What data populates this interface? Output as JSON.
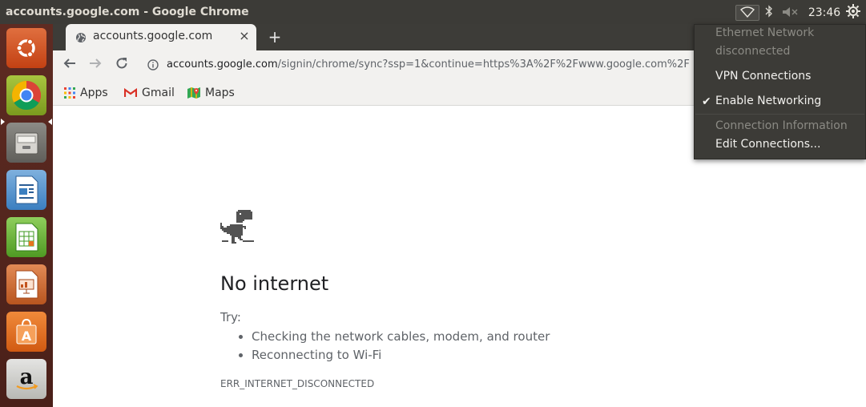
{
  "topbar": {
    "window_title": "accounts.google.com - Google Chrome",
    "indicators": {
      "network_icon": "wifi-icon",
      "bluetooth_icon": "bluetooth-icon",
      "volume_icon": "volume-muted-icon",
      "clock": "23:46",
      "session_icon": "gear-icon"
    }
  },
  "launcher": {
    "items": [
      {
        "name": "ubuntu-dash",
        "icon": "ubuntu-logo-icon"
      },
      {
        "name": "google-chrome",
        "icon": "chrome-icon",
        "active": true
      },
      {
        "name": "files",
        "icon": "file-cabinet-icon"
      },
      {
        "name": "libreoffice-writer",
        "icon": "writer-icon"
      },
      {
        "name": "libreoffice-calc",
        "icon": "calc-icon"
      },
      {
        "name": "libreoffice-impress",
        "icon": "impress-icon"
      },
      {
        "name": "ubuntu-software",
        "icon": "shopping-bag-icon"
      },
      {
        "name": "amazon",
        "icon": "amazon-icon"
      }
    ]
  },
  "browser": {
    "tab": {
      "title": "accounts.google.com",
      "close": "×"
    },
    "new_tab": "+",
    "omnibox": {
      "host": "accounts.google.com",
      "path": "/signin/chrome/sync?ssp=1&continue=https%3A%2F%2Fwww.google.com%2F"
    },
    "bookmarks": [
      {
        "label": "Apps",
        "icon": "apps-grid-icon"
      },
      {
        "label": "Gmail",
        "icon": "gmail-icon"
      },
      {
        "label": "Maps",
        "icon": "maps-icon"
      }
    ]
  },
  "error_page": {
    "title": "No internet",
    "try_label": "Try:",
    "suggestions": [
      "Checking the network cables, modem, and router",
      "Reconnecting to Wi-Fi"
    ],
    "code": "ERR_INTERNET_DISCONNECTED"
  },
  "network_menu": {
    "status_line1": "Ethernet Network",
    "status_line2": "disconnected",
    "vpn": "VPN Connections",
    "enable_networking": "Enable Networking",
    "enable_networking_checked": true,
    "check_mark": "✔",
    "connection_info": "Connection Information",
    "edit_connections": "Edit Connections..."
  },
  "colors": {
    "panel_bg": "#3c3b37",
    "launcher_bg": "#5b2a22",
    "chrome_frame": "#3d3c38",
    "toolbar_bg": "#f2f1ef"
  }
}
